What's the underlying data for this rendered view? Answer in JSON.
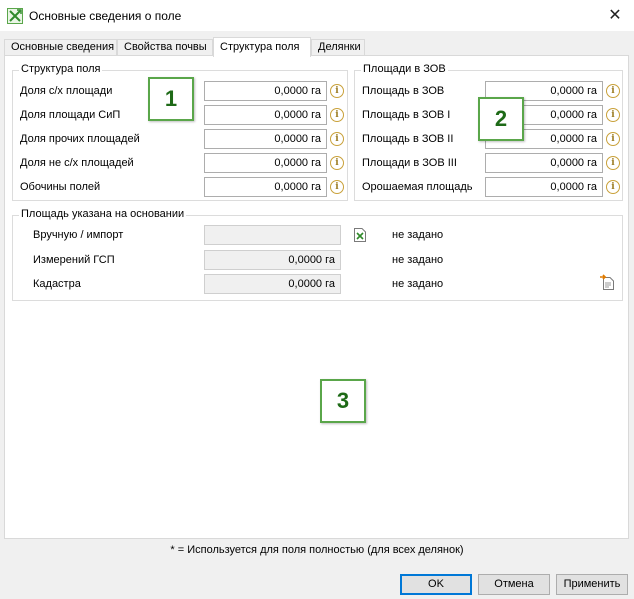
{
  "window": {
    "title": "Основные сведения о поле",
    "close_glyph": "✕"
  },
  "tabs": [
    {
      "label": "Основные сведения"
    },
    {
      "label": "Свойства почвы"
    },
    {
      "label": "Структура поля"
    },
    {
      "label": "Делянки"
    }
  ],
  "structure": {
    "title": "Структура поля",
    "rows": [
      {
        "label": "Доля с/х площади",
        "value": "0,0000 га"
      },
      {
        "label": "Доля площади СиП",
        "value": "0,0000 га"
      },
      {
        "label": "Доля прочих площадей",
        "value": "0,0000 га"
      },
      {
        "label": "Доля не с/х площадей",
        "value": "0,0000 га"
      },
      {
        "label": "Обочины полей",
        "value": "0,0000 га"
      }
    ]
  },
  "zov": {
    "title": "Площади в ЗОВ",
    "rows": [
      {
        "label": "Площадь в ЗОВ",
        "value": "0,0000 га"
      },
      {
        "label": "Площадь в ЗОВ I",
        "value": "0,0000 га"
      },
      {
        "label": "Площадь в ЗОВ II",
        "value": "0,0000 га"
      },
      {
        "label": "Площади в ЗОВ III",
        "value": "0,0000 га"
      },
      {
        "label": "Орошаемая площадь",
        "value": "0,0000 га"
      }
    ]
  },
  "basis": {
    "title": "Площадь указана на основании",
    "rows": [
      {
        "label": "Вручную / импорт",
        "value": "",
        "status": "не задано"
      },
      {
        "label": "Измерений ГСП",
        "value": "0,0000 га",
        "status": "не задано"
      },
      {
        "label": "Кадастра",
        "value": "0,0000 га",
        "status": "не задано"
      }
    ]
  },
  "callouts": [
    "1",
    "2",
    "3"
  ],
  "footnote": "* = Используется для поля полностью (для всех делянок)",
  "buttons": {
    "ok": "OK",
    "cancel": "Отмена",
    "apply": "Применить"
  },
  "info_glyph": "i"
}
